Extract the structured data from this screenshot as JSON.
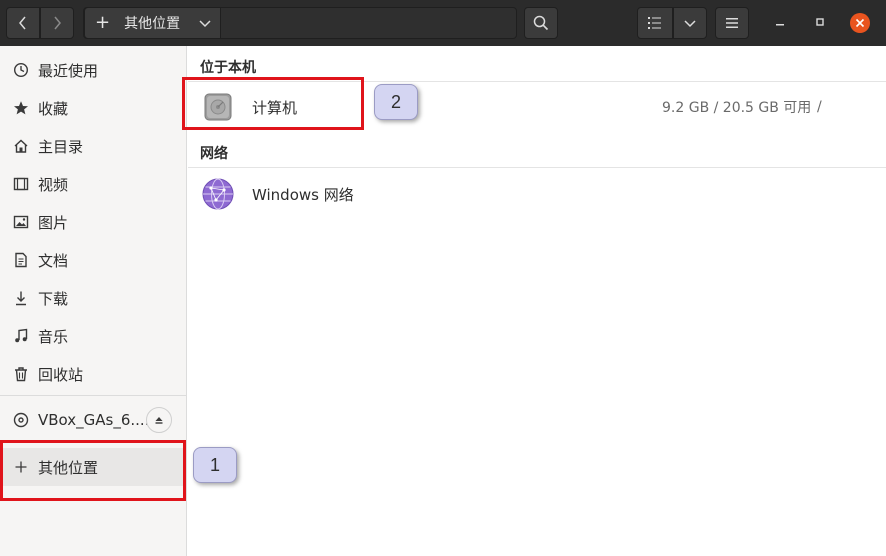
{
  "header": {
    "back_icon": "chevron-left-icon",
    "forward_icon": "chevron-right-icon",
    "path_label": "其他位置",
    "path_add_icon": "plus-icon",
    "path_dropdown_icon": "chevron-down-icon",
    "search_icon": "search-icon",
    "view_list_icon": "list-view-icon",
    "view_dropdown_icon": "chevron-down-icon",
    "menu_icon": "hamburger-menu-icon",
    "window_controls": [
      "minimize-icon",
      "maximize-icon",
      "close-icon"
    ]
  },
  "sidebar": {
    "items": [
      {
        "label": "最近使用",
        "icon": "clock-icon"
      },
      {
        "label": "收藏",
        "icon": "star-icon"
      },
      {
        "label": "主目录",
        "icon": "home-icon"
      },
      {
        "label": "视频",
        "icon": "film-icon"
      },
      {
        "label": "图片",
        "icon": "image-icon"
      },
      {
        "label": "文档",
        "icon": "document-icon"
      },
      {
        "label": "下载",
        "icon": "download-icon"
      },
      {
        "label": "音乐",
        "icon": "music-icon"
      },
      {
        "label": "回收站",
        "icon": "trash-icon"
      }
    ],
    "device": {
      "label": "VBox_GAs_6....",
      "icon": "disc-icon",
      "eject_icon": "eject-icon"
    },
    "other_locations": {
      "label": "其他位置",
      "icon": "plus-icon",
      "active": true
    }
  },
  "main": {
    "section_local": "位于本机",
    "computer": {
      "name": "计算机",
      "usage": "9.2 GB / 20.5 GB 可用",
      "mount": "/",
      "icon": "hard-drive-icon"
    },
    "section_network": "网络",
    "network": {
      "name": "Windows 网络",
      "icon": "network-globe-icon"
    }
  },
  "annotations": {
    "badge_1": "1",
    "badge_2": "2",
    "highlight_color": "#e0141b",
    "badge_color": "#d4d5f2"
  },
  "colors": {
    "accent": "#e9541f",
    "headerbar": "#2b2b2b",
    "sidebar_bg": "#f6f5f4"
  }
}
